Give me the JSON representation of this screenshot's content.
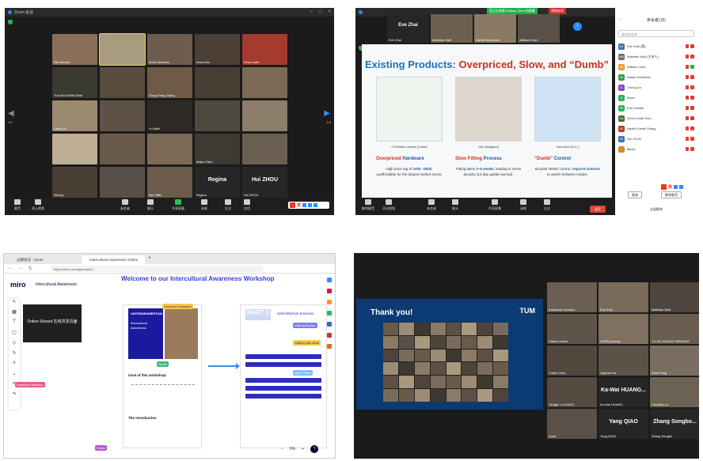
{
  "colors": {
    "zoom_blue": "#2d8cff",
    "zoom_green": "#23b14d",
    "miro_title": "#3c3cd6",
    "tum_navy": "#0c3a73",
    "slide_blue": "#1e73b8",
    "slide_red": "#c8321e"
  },
  "zoom_gallery": {
    "title": "Zoom 会议",
    "page_left": "1/2",
    "page_right": "1/2",
    "tiles": [
      {
        "name": "Nur Ahmed",
        "bg": "#8a6f5a"
      },
      {
        "name": "",
        "bg": "#a99b7f",
        "active": true
      },
      {
        "name": "Anna Sanchez",
        "bg": "#6e5d4e"
      },
      {
        "name": "Iman Kim",
        "bg": "#4c4036"
      },
      {
        "name": "Kina Lewis",
        "bg": "#a53a2e"
      },
      {
        "name": "Yun Wu HONG Mak",
        "bg": "#3a3a30"
      },
      {
        "name": "",
        "bg": "#5a4c3c"
      },
      {
        "name": "Gong Peng Zhang",
        "bg": "#6f5a48"
      },
      {
        "name": "",
        "bg": "#493e33"
      },
      {
        "name": "",
        "bg": "#7b6b55"
      },
      {
        "name": "Chen Lu",
        "bg": "#9c8a70"
      },
      {
        "name": "",
        "bg": "#5d5148"
      },
      {
        "name": "Yu Mimi",
        "bg": "#2d2a25"
      },
      {
        "name": "",
        "bg": "#4e4a40"
      },
      {
        "name": "",
        "bg": "#8c7c6a"
      },
      {
        "name": "",
        "bg": "#bfae95"
      },
      {
        "name": "",
        "bg": "#6a5a4c"
      },
      {
        "name": "",
        "bg": "#7c6a56"
      },
      {
        "name": "Mako Chen",
        "bg": "#3e3a34"
      },
      {
        "name": "",
        "bg": "#6b5f52"
      },
      {
        "name": "Wendy",
        "bg": "#4a3f35"
      },
      {
        "name": "",
        "bg": "#57504a"
      },
      {
        "name": "Ben Mills",
        "bg": "#6c5b4a"
      },
      {
        "name": "Regina",
        "big": "Regina",
        "bg": "#262626"
      },
      {
        "name": "Hui ZHOU",
        "big": "Hui ZHOU",
        "bg": "#262626"
      }
    ],
    "toolbar": [
      {
        "label": "静音",
        "style": ""
      },
      {
        "label": "停止视频",
        "style": ""
      },
      {
        "label": "参会者",
        "style": ""
      },
      {
        "label": "聊天",
        "style": ""
      },
      {
        "label": "共享屏幕",
        "style": "green"
      },
      {
        "label": "录制",
        "style": ""
      },
      {
        "label": "反应",
        "style": ""
      },
      {
        "label": "应用",
        "style": ""
      }
    ],
    "ime_label": "英"
  },
  "zoom_share": {
    "share_banner": "您正在观看 William Chen 的屏幕",
    "view_options": "视图选项",
    "thumbs": [
      {
        "name": "Eve Zhai",
        "big": "Eve Zhai",
        "bg": "#262626"
      },
      {
        "name": "Matthias Wolf",
        "bg": "#6c6050"
      },
      {
        "name": "Daniel Schneider",
        "bg": "#8a7a64"
      },
      {
        "name": "William Chen",
        "bg": "#5a5048"
      }
    ],
    "slide": {
      "title_plain": "Existing Products: ",
      "title_hot": "Overpriced, Slow, and “Dumb”",
      "products": [
        {
          "caption": "OYMotion Ohand (China)",
          "head_pre": "Overpriced ",
          "head_post": "Hardware",
          "body_pre": "High price tag of ",
          "body_bold": "100k –500k",
          "body_post": ", unaffordable for the largest market sector.",
          "color": "#eef3ee"
        },
        {
          "caption": "Ohh (Belgium)",
          "head_pre": "Slow Fitting ",
          "head_post": "Process",
          "body_pre": "Fitting takes ",
          "body_bold": "3–6 weeks",
          "body_post": ", leading to nerve atrophy (14-day golden period).",
          "color": "#dcd6cc"
        },
        {
          "caption": "Hero Arm (U.K.)",
          "head_pre": "“Dumb” ",
          "head_post": "Control",
          "body_pre": "Bi-polar sEMG control, ",
          "body_bold": "requires buttons",
          "body_post": " to switch between modes.",
          "color": "#cfe2f3"
        }
      ]
    },
    "panel": {
      "title": "参会者(15)",
      "search_placeholder": "查找参会者",
      "participants": [
        {
          "initials": "EZ",
          "name": "Eve Zhai (我)",
          "color": "#3f6fb5",
          "cam_on": false
        },
        {
          "initials": "MW",
          "name": "Matthias Wolf (主持人)",
          "color": "#6a6a6a",
          "cam_on": false
        },
        {
          "initials": "WC",
          "name": "William Chen",
          "color": "#e79a2a",
          "cam_on": true
        },
        {
          "initials": "AD",
          "name": "Adrian Dembeke",
          "color": "#2f9e4f",
          "cam_on": false
        },
        {
          "initials": "CL",
          "name": "Cheng Lin",
          "color": "#8a46c2",
          "cam_on": false
        },
        {
          "initials": "D",
          "name": "david",
          "color": "#2fae5b",
          "cam_on": false
        },
        {
          "initials": "EK",
          "name": "Erik Kessler",
          "color": "#2fae5b",
          "cam_on": false
        },
        {
          "initials": "GA",
          "name": "Green Audit Tech",
          "color": "#4a6a2f",
          "cam_on": false
        },
        {
          "initials": "HZ",
          "name": "Haofei Daniel Zhang",
          "color": "#c8321e",
          "cam_on": false
        },
        {
          "initials": "HZ",
          "name": "Hui ZHOU",
          "color": "#3f6fb5",
          "cam_on": false
        },
        {
          "initials": "I",
          "name": "ifboxe",
          "color": "#d8861f",
          "cam_on": false
        }
      ],
      "invite_label": "邀请",
      "unmute_label": "解除静音",
      "footer": "全部解除"
    },
    "toolbar": [
      {
        "label": "解除静音"
      },
      {
        "label": "开启视频"
      },
      {
        "label": "参会者"
      },
      {
        "label": "聊天"
      },
      {
        "label": "共享屏幕"
      },
      {
        "label": "录制"
      },
      {
        "label": "反应"
      }
    ],
    "end_label": "离开"
  },
  "miro": {
    "tab1": "过期会议 - Zoom",
    "tab2": "Intercultural Awareness Online",
    "url": "https://miro.com/app/board/...",
    "logo": "miro",
    "board_name": "Intercultural Awareness",
    "board_title": "Welcome to our Intercultural Awareness Workshop",
    "sticky": "Online Shared 在线共享页面",
    "cursor1": "Christina Schneider",
    "cursor2": "Guest",
    "cursor3": "Learning Facilitator",
    "cursor4": "Guest",
    "block": {
      "line1": "UNTERNEHMERTUM",
      "line2": "Intercultural Awareness"
    },
    "goal": "Goal of this workshop:",
    "intro": "The introduction",
    "part": "PART 1",
    "self_reflection": "Self-reflection Exercise",
    "tags": [
      "Visiting Abroad",
      "Visiting Abroad",
      "Visiting, this idea!",
      "Open Stack"
    ],
    "zoom_pct": "9%"
  },
  "zoom_thanks": {
    "thank_you": "Thank you!",
    "tum": "TUM",
    "tiles": [
      {
        "name": "Katharina Schwarz",
        "bg": "#6b5e52"
      },
      {
        "name": "Eve Zhai",
        "bg": "#7a6a5a"
      },
      {
        "name": "Matthias Wolf",
        "bg": "#4e463e"
      },
      {
        "name": "Patrick Huber",
        "bg": "#5f544a"
      },
      {
        "name": "CHEN Linning",
        "bg": "#807060"
      },
      {
        "name": "YU-AN HWANG WEIMING",
        "bg": "#6a5c4e"
      },
      {
        "name": "Yunjin Chen",
        "bg": "#52483e"
      },
      {
        "name": "Jingnan Hu",
        "bg": "#5c5248"
      },
      {
        "name": "Xinlu Fang",
        "bg": "#7a6e62"
      },
      {
        "name": "Tengjie Li HUANG",
        "bg": "#544a40"
      },
      {
        "name": "Ka-Wai HUANG...",
        "big": "Ka-Wai HUANG...",
        "bg": "#262626"
      },
      {
        "name": "Christian Lu",
        "bg": "#6b6254"
      },
      {
        "name": "Anna",
        "bg": "#5a5048"
      },
      {
        "name": "Yang QIAO",
        "big": "Yang QIAO",
        "bg": "#262626"
      },
      {
        "name": "Zhang Songbo",
        "big": "Zhang Songbo...",
        "bg": "#262626"
      }
    ]
  }
}
